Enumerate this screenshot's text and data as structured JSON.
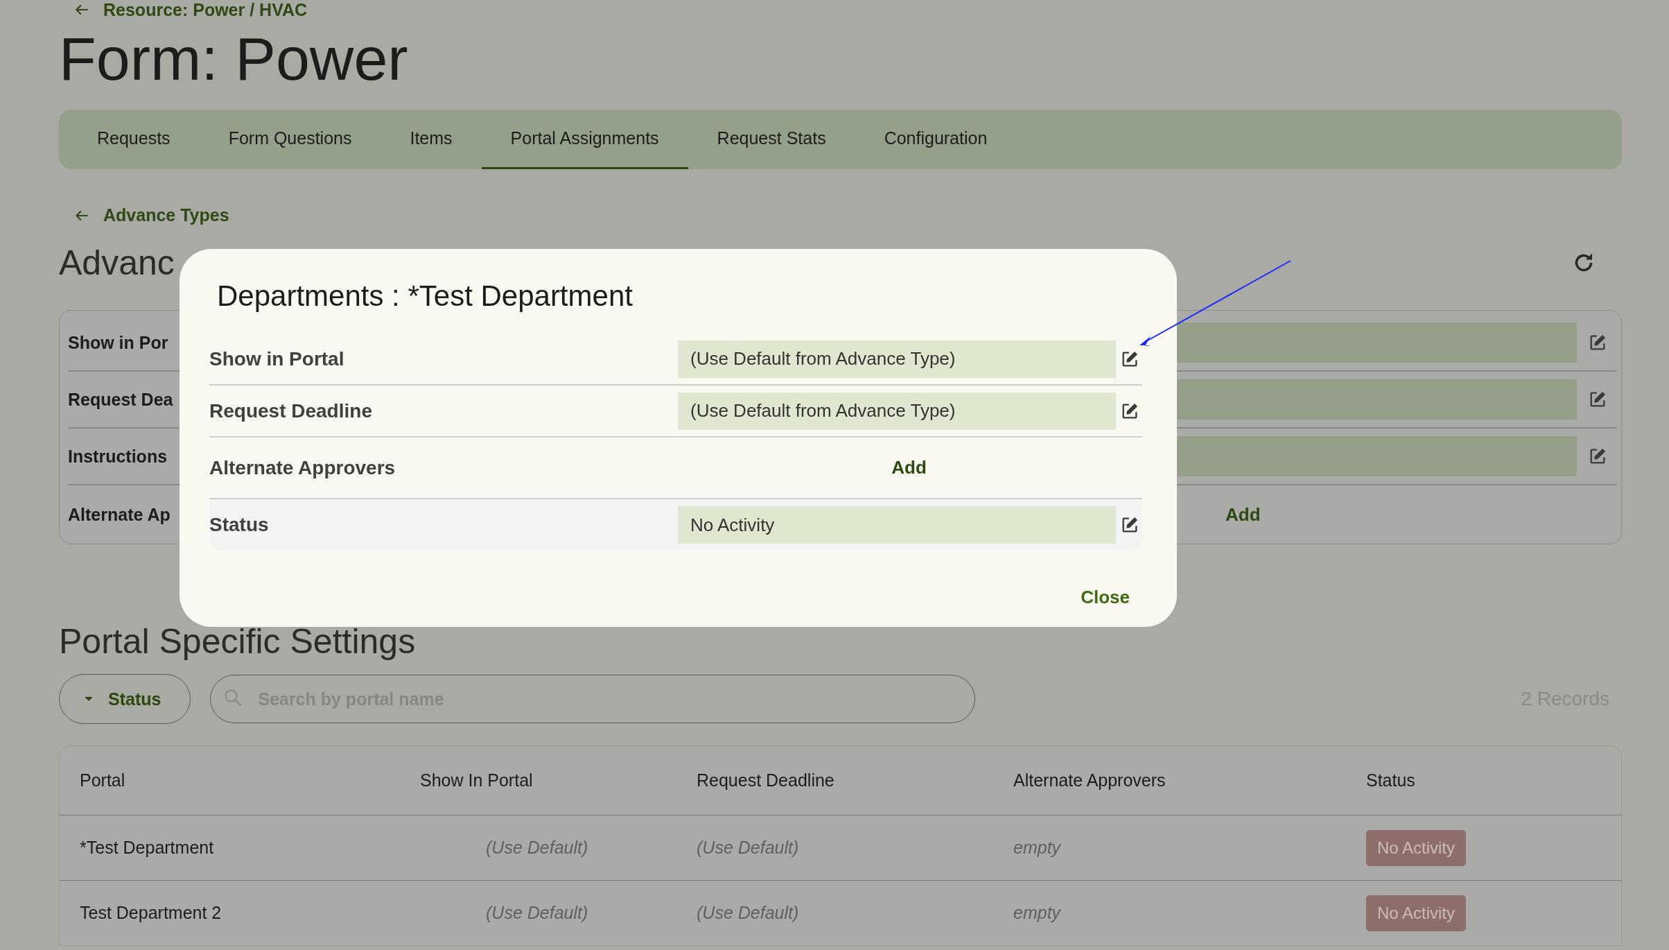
{
  "breadcrumb": {
    "label": "Resource: Power / HVAC"
  },
  "page_title": "Form: Power",
  "tabs": [
    {
      "label": "Requests",
      "selected": false
    },
    {
      "label": "Form Questions",
      "selected": false
    },
    {
      "label": "Items",
      "selected": false
    },
    {
      "label": "Portal Assignments",
      "selected": true
    },
    {
      "label": "Request Stats",
      "selected": false
    },
    {
      "label": "Configuration",
      "selected": false
    }
  ],
  "back_link": {
    "label": "Advance Types"
  },
  "section_title": "Advanc",
  "settings_card": {
    "rows": [
      {
        "label": "Show in Por",
        "kind": "field"
      },
      {
        "label": "Request Dea",
        "kind": "field"
      },
      {
        "label": "Instructions",
        "kind": "field"
      },
      {
        "label": "Alternate Ap",
        "kind": "add",
        "action": "Add"
      }
    ]
  },
  "portal_section": {
    "title": "Portal Specific Settings",
    "filter": {
      "label": "Status"
    },
    "search": {
      "placeholder": "Search by portal name"
    },
    "record_count": "2 Records",
    "table": {
      "columns": [
        "Portal",
        "Show In Portal",
        "Request Deadline",
        "Alternate Approvers",
        "Status"
      ],
      "rows": [
        {
          "portal": "*Test Department",
          "show_in_portal": "(Use Default)",
          "request_deadline": "(Use Default)",
          "alternate_approvers": "empty",
          "status": "No Activity"
        },
        {
          "portal": "Test Department 2",
          "show_in_portal": "(Use Default)",
          "request_deadline": "(Use Default)",
          "alternate_approvers": "empty",
          "status": "No Activity"
        }
      ]
    }
  },
  "dialog": {
    "title": "Departments : *Test Department",
    "rows": [
      {
        "label": "Show in Portal",
        "kind": "field",
        "value": "(Use Default from Advance Type)",
        "hovered": false
      },
      {
        "label": "Request Deadline",
        "kind": "field",
        "value": "(Use Default from Advance Type)",
        "hovered": false
      },
      {
        "label": "Alternate Approvers",
        "kind": "add",
        "action": "Add",
        "hovered": false
      },
      {
        "label": "Status",
        "kind": "field",
        "value": "No Activity",
        "hovered": true
      }
    ],
    "close": "Close"
  }
}
